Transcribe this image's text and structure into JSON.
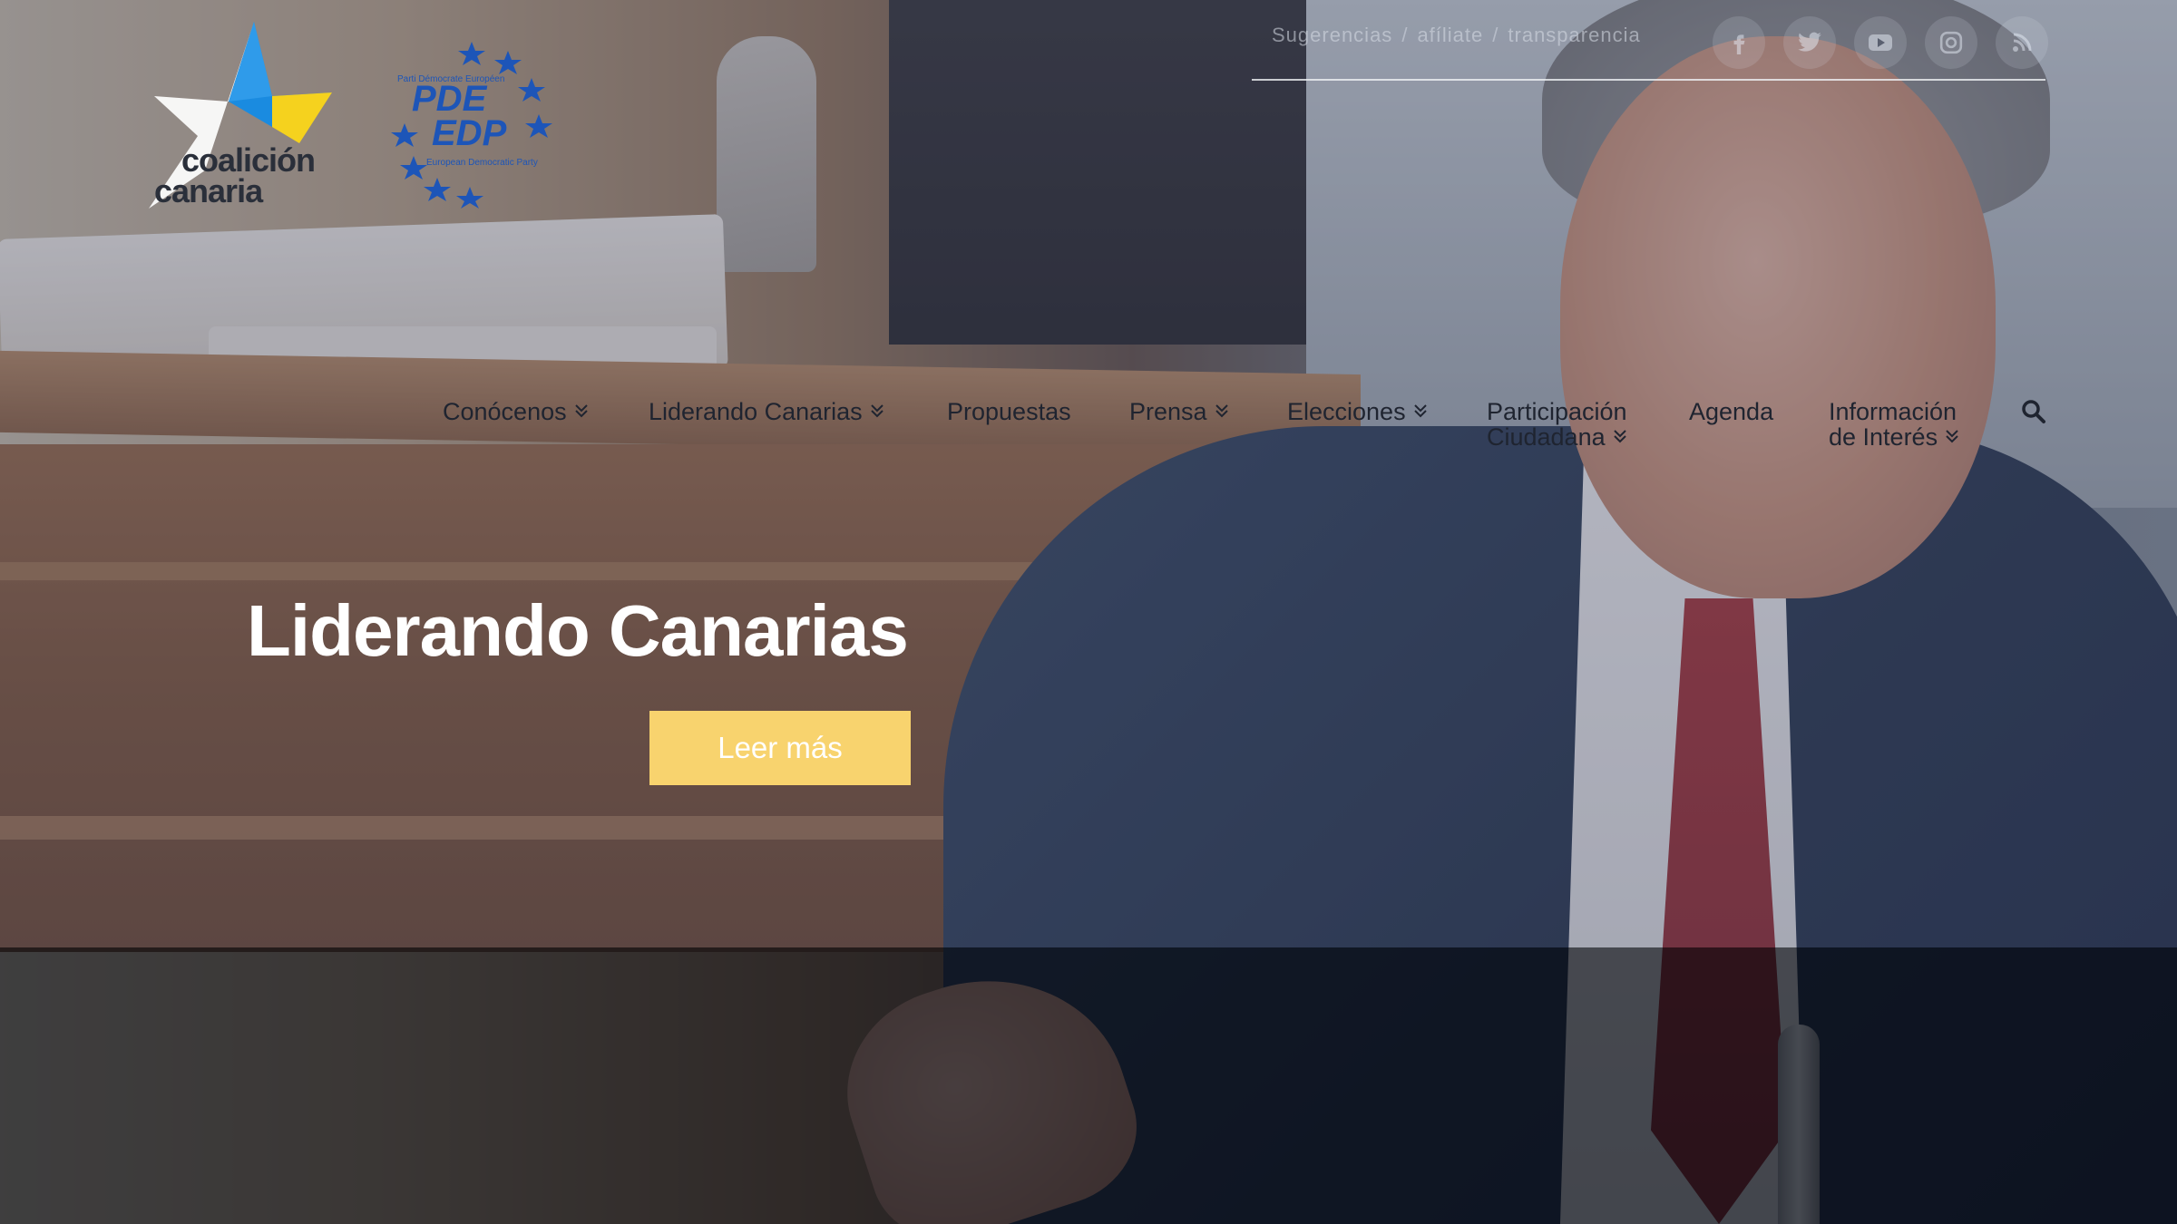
{
  "brand": {
    "logo_cc_line1": "coalición",
    "logo_cc_line2": "canaria",
    "logo_pde_line1": "PDE",
    "logo_pde_line2": "EDP",
    "logo_pde_top": "Parti Démocrate Européen",
    "logo_pde_bottom": "European Democratic Party",
    "colors": {
      "star_blue": "#1a8be0",
      "star_yellow": "#f5d21e",
      "star_white": "#ffffff",
      "pde_blue": "#1d55b8"
    }
  },
  "utility_nav": {
    "links": [
      "Sugerencias",
      "afíliate",
      "transparencia"
    ],
    "separator": "/",
    "social_icons": [
      "facebook-icon",
      "twitter-icon",
      "youtube-icon",
      "instagram-icon",
      "rss-icon"
    ]
  },
  "main_nav": {
    "items": [
      {
        "label": "Conócenos",
        "has_dropdown": true
      },
      {
        "label": "Liderando Canarias",
        "has_dropdown": true
      },
      {
        "label": "Propuestas",
        "has_dropdown": false
      },
      {
        "label": "Prensa",
        "has_dropdown": true
      },
      {
        "label": "Elecciones",
        "has_dropdown": true
      },
      {
        "label_line1": "Participación",
        "label_line2": "Ciudadana",
        "has_dropdown": true
      },
      {
        "label": "Agenda",
        "has_dropdown": false
      },
      {
        "label_line1": "Información",
        "label_line2": "de Interés",
        "has_dropdown": true
      }
    ],
    "search_icon": "search-icon"
  },
  "hero": {
    "title": "Liderando Canarias",
    "cta_label": "Leer más",
    "cta_color": "#f8d36e"
  }
}
